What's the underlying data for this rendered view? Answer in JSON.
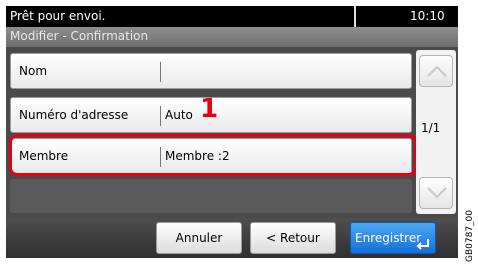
{
  "status": {
    "message": "Prêt pour envoi.",
    "time": "10:10"
  },
  "title": "Modifier - Confirmation",
  "rows": [
    {
      "label": "Nom",
      "value": ""
    },
    {
      "label": "Numéro d'adresse",
      "value": "Auto"
    },
    {
      "label": "Membre",
      "value": "Membre :2"
    }
  ],
  "callout": "1",
  "pagination": "1/1",
  "buttons": {
    "cancel": "Annuler",
    "back": "< Retour",
    "save": "Enregistrer"
  },
  "figure_code": "GB0787_00",
  "colors": {
    "highlight": "#e60012",
    "primary_button": "#1e7fe0"
  },
  "icons": {
    "scroll_up": "chevron-up-icon",
    "scroll_down": "chevron-down-icon",
    "enter": "enter-icon"
  }
}
